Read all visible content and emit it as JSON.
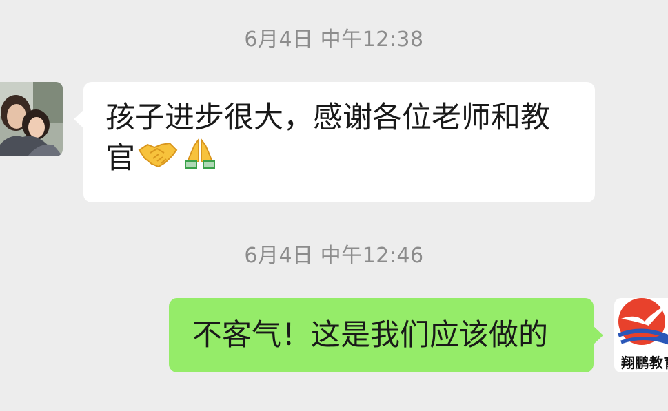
{
  "messages": [
    {
      "timestamp": "6月4日 中午12:38",
      "direction": "incoming",
      "text_line1": "孩子进步很大，感谢各位老师和教",
      "text_line2": "官",
      "emojis": [
        "handshake-emoji",
        "folded-hands-emoji"
      ]
    },
    {
      "timestamp": "6月4日 中午12:46",
      "direction": "outgoing",
      "text": "不客气！这是我们应该做的",
      "sender_logo_text": "翔鹏教育"
    }
  ],
  "colors": {
    "background": "#ededed",
    "incoming_bubble": "#ffffff",
    "outgoing_bubble": "#95ec69",
    "timestamp_text": "#8c8c8c",
    "logo_red": "#e8412c",
    "logo_blue": "#2a57b8"
  }
}
